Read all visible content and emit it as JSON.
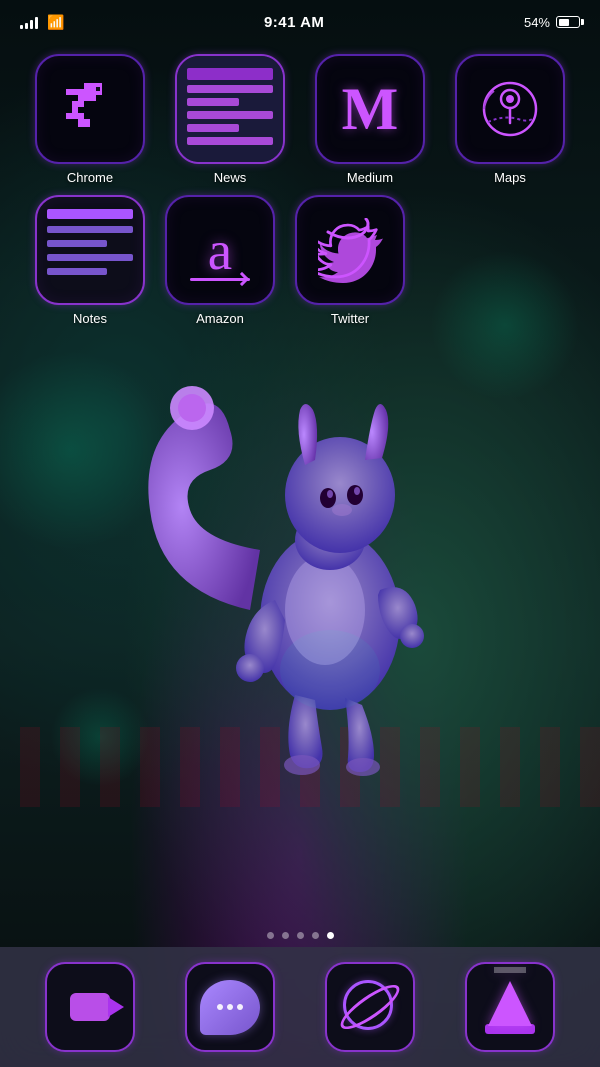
{
  "statusBar": {
    "time": "9:41 AM",
    "battery": "54%",
    "batteryFill": "54"
  },
  "apps": {
    "row1": [
      {
        "name": "Chrome",
        "id": "chrome"
      },
      {
        "name": "News",
        "id": "news"
      },
      {
        "name": "Medium",
        "id": "medium"
      },
      {
        "name": "Maps",
        "id": "maps"
      }
    ],
    "row2": [
      {
        "name": "Notes",
        "id": "notes"
      },
      {
        "name": "Amazon",
        "id": "amazon"
      },
      {
        "name": "Twitter",
        "id": "twitter"
      }
    ]
  },
  "dock": [
    {
      "name": "FaceTime",
      "id": "facetime"
    },
    {
      "name": "Messages",
      "id": "messages"
    },
    {
      "name": "Explorer",
      "id": "explorer"
    },
    {
      "name": "VLC",
      "id": "vlc"
    }
  ],
  "pageDots": [
    {
      "active": false
    },
    {
      "active": false
    },
    {
      "active": false
    },
    {
      "active": false
    },
    {
      "active": true
    }
  ]
}
